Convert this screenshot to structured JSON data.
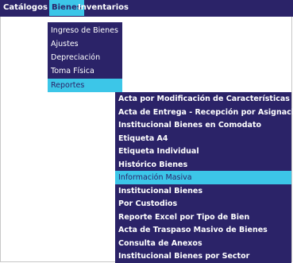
{
  "menubar": {
    "items": [
      {
        "label": "Catálogos"
      },
      {
        "label": "Bienes"
      },
      {
        "label": "Inventarios"
      }
    ]
  },
  "bienes_menu": {
    "items": [
      {
        "label": "Ingreso de Bienes"
      },
      {
        "label": "Ajustes"
      },
      {
        "label": "Depreciación"
      },
      {
        "label": "Toma Física"
      },
      {
        "label": "Reportes"
      }
    ]
  },
  "reportes_menu": {
    "items": [
      {
        "label": "Acta por Modificación de Características"
      },
      {
        "label": "Acta de Entrega - Recepción por Asignación"
      },
      {
        "label": "Institucional Bienes en Comodato"
      },
      {
        "label": "Etiqueta A4"
      },
      {
        "label": "Etiqueta Individual"
      },
      {
        "label": "Histórico Bienes"
      },
      {
        "label": "Información Masiva"
      },
      {
        "label": "Institucional Bienes"
      },
      {
        "label": "Por Custodios"
      },
      {
        "label": "Reporte Excel por Tipo de Bien"
      },
      {
        "label": "Acta de Traspaso Masivo de Bienes"
      },
      {
        "label": "Consulta de Anexos"
      },
      {
        "label": "Institucional Bienes por Sector"
      }
    ]
  }
}
